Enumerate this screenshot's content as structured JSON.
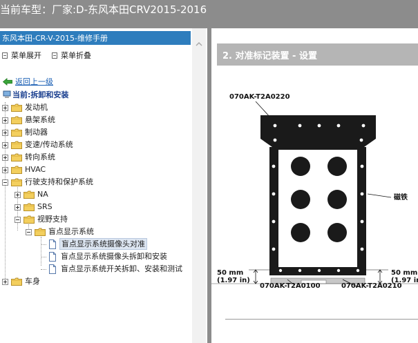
{
  "window": {
    "title": "当前车型：厂家:D-东风本田CRV2015-2016"
  },
  "left_panel": {
    "header": "东风本田-CR-V-2015-维修手册",
    "toolbar": {
      "expand_all": "菜单展开",
      "collapse_all": "菜单折叠"
    },
    "back_link": "返回上一级",
    "current": "当前:拆卸和安装",
    "tree": {
      "engine": "发动机",
      "suspension": "悬架系统",
      "brakes": "制动器",
      "transmission": "变速/传动系统",
      "steering": "转向系统",
      "hvac": "HVAC",
      "restraints": "行驶支持和保护系统",
      "na": "NA",
      "srs": "SRS",
      "vision": "视野支持",
      "blind_spot": "盲点显示系统",
      "doc1": "盲点显示系统摄像头对准",
      "doc2": "盲点显示系统摄像头拆卸和安装",
      "doc3": "盲点显示系统开关拆卸、安装和测试",
      "body": "车身"
    }
  },
  "content": {
    "section_title": "2. 对准标记装置 - 设置",
    "diagram": {
      "part_top": "070AK-T2A0220",
      "magnet_label": "磁铁",
      "distance_left_mm": "50 mm",
      "distance_left_in": "(1.97 in)",
      "distance_right_mm": "50 mm",
      "distance_right_in": "(1.97 in",
      "part_bottom_left": "070AK-T2A0100",
      "part_bottom_right": "070AK-T2A0210"
    }
  },
  "colors": {
    "titlebar": "#8c8c8c",
    "panel_header": "#2e7dbd",
    "section_header": "#b5b5b5",
    "folder": "#f3cf5e",
    "link": "#1a5fb4"
  },
  "icons": {
    "back": "back-arrow-icon",
    "current": "computer-icon",
    "folder": "folder-icon",
    "document": "document-icon",
    "scroll_up": "chevron-up-icon"
  }
}
